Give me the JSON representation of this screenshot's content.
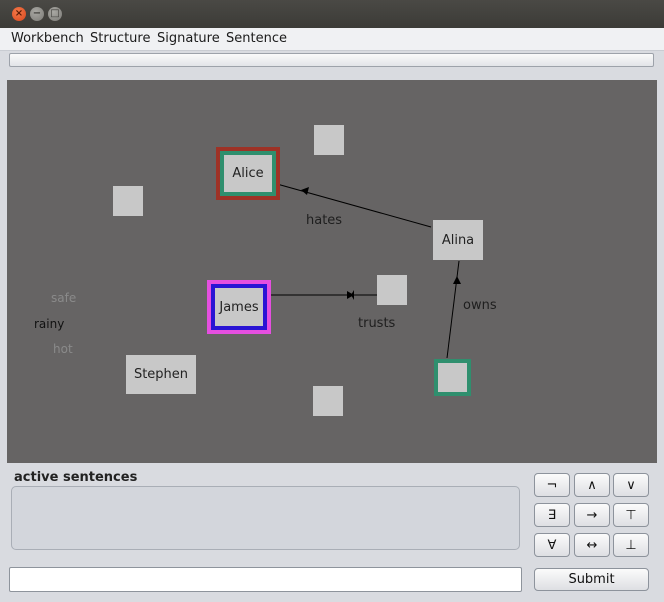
{
  "window": {
    "close_glyph": "×",
    "minimize_glyph": "−",
    "maximize_glyph": "□"
  },
  "menu": [
    "Workbench",
    "Structure",
    "Signature",
    "Sentence"
  ],
  "world": {
    "objects": {
      "alice": "Alice",
      "alina": "Alina",
      "james": "James",
      "stephen": "Stephen"
    },
    "relations": {
      "hates": "hates",
      "trusts": "trusts",
      "owns": "owns"
    },
    "predicates": {
      "safe": "safe",
      "rainy": "rainy",
      "hot": "hot"
    }
  },
  "sentences_panel": {
    "title": "active sentences"
  },
  "symbols": [
    "¬",
    "∧",
    "∨",
    "∃",
    "→",
    "⊤",
    "∀",
    "↔",
    "⊥"
  ],
  "input": {
    "value": "",
    "placeholder": ""
  },
  "submit_label": "Submit",
  "colors": {
    "canvas": "#666464",
    "object": "#c8c8c8",
    "alice_outer": "#9e3226",
    "alice_inner": "#2f8f6e",
    "james_outer": "#e54fe0",
    "james_inner": "#2a14d4",
    "unnamed_border": "#2f8f6e"
  }
}
